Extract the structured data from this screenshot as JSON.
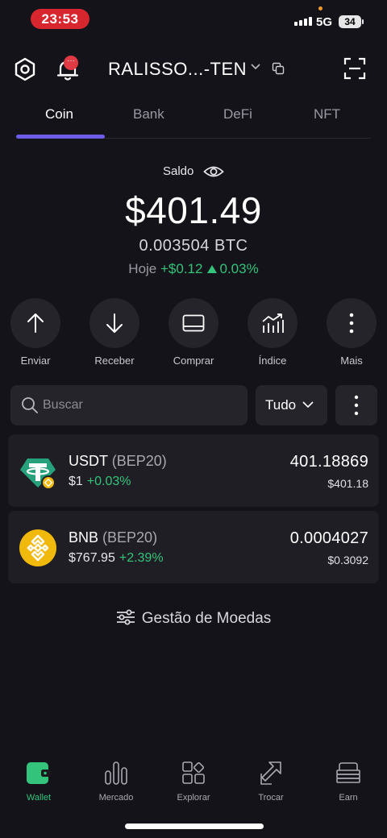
{
  "status_bar": {
    "time": "23:53",
    "network": "5G",
    "battery": "34"
  },
  "header": {
    "wallet_name": "RALISSO...-TEN",
    "notification_badge": "···"
  },
  "tabs": [
    {
      "label": "Coin",
      "active": true
    },
    {
      "label": "Bank",
      "active": false
    },
    {
      "label": "DeFi",
      "active": false
    },
    {
      "label": "NFT",
      "active": false
    }
  ],
  "balance": {
    "label": "Saldo",
    "amount": "$401.49",
    "btc": "0.003504 BTC",
    "today_label": "Hoje",
    "today_change": "+$0.12",
    "today_percent": "0.03%"
  },
  "actions": [
    {
      "label": "Enviar",
      "icon": "arrow-up-icon"
    },
    {
      "label": "Receber",
      "icon": "arrow-down-icon"
    },
    {
      "label": "Comprar",
      "icon": "card-icon"
    },
    {
      "label": "Índice",
      "icon": "chart-trend-icon"
    },
    {
      "label": "Mais",
      "icon": "more-vertical-icon"
    }
  ],
  "search": {
    "placeholder": "Buscar",
    "filter": "Tudo"
  },
  "assets": [
    {
      "symbol": "USDT",
      "network": "(BEP20)",
      "price": "$1",
      "change": "+0.03%",
      "amount": "401.18869",
      "value": "$401.18",
      "color": "#26a17b"
    },
    {
      "symbol": "BNB",
      "network": "(BEP20)",
      "price": "$767.95",
      "change": "+2.39%",
      "amount": "0.0004027",
      "value": "$0.3092",
      "color": "#f0b90b"
    }
  ],
  "manage_label": "Gestão de Moedas",
  "bottom_nav": [
    {
      "label": "Wallet",
      "active": true
    },
    {
      "label": "Mercado",
      "active": false
    },
    {
      "label": "Explorar",
      "active": false
    },
    {
      "label": "Trocar",
      "active": false
    },
    {
      "label": "Earn",
      "active": false
    }
  ],
  "colors": {
    "accent": "#6d5ce8",
    "positive": "#34c37b",
    "background": "#141319",
    "card": "#1f1e24"
  }
}
